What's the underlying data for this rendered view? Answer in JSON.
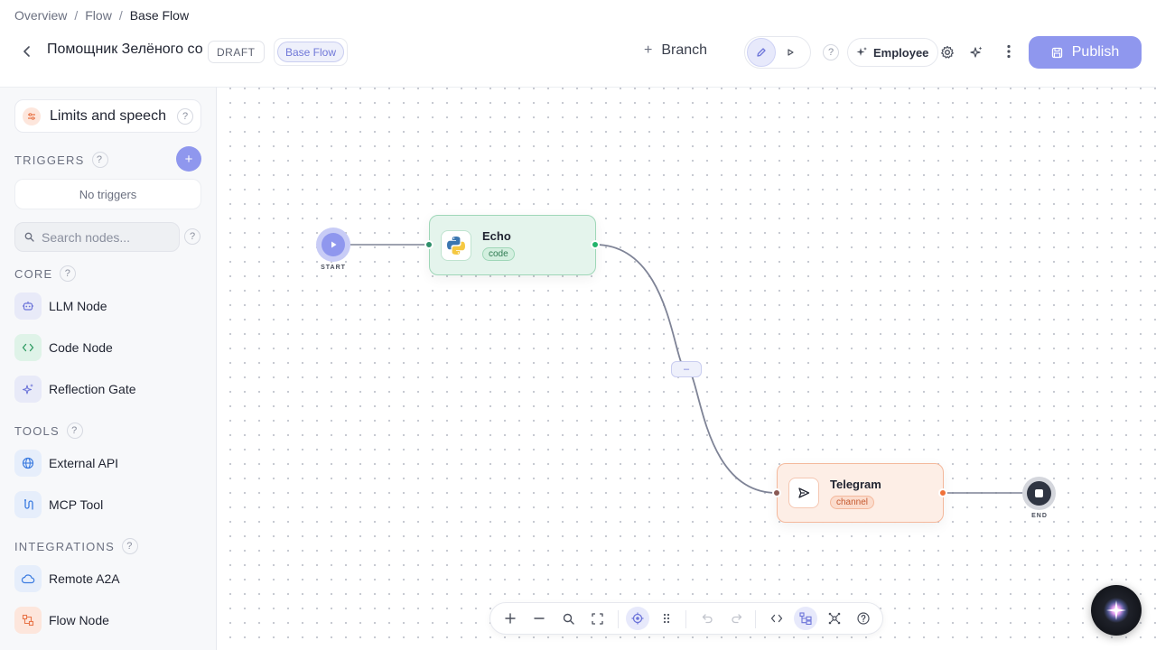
{
  "breadcrumb": {
    "items": [
      "Overview",
      "Flow"
    ],
    "current": "Base Flow",
    "separator": "/"
  },
  "header": {
    "title": "Помощник Зелёного со",
    "status_badge": "DRAFT",
    "flow_pill": "Base Flow",
    "branch_label": "Branch",
    "help_mark": "?",
    "employee_label": "Employee",
    "publish_label": "Publish"
  },
  "sidebar": {
    "limits_card": "Limits and speech",
    "help_mark": "?",
    "triggers_label": "TRIGGERS",
    "add_trigger": "+",
    "no_triggers": "No triggers",
    "search_placeholder": "Search nodes...",
    "core_label": "CORE",
    "core_items": [
      {
        "label": "LLM Node",
        "icon": "robot-icon"
      },
      {
        "label": "Code Node",
        "icon": "code-icon"
      },
      {
        "label": "Reflection Gate",
        "icon": "sparkle-icon"
      }
    ],
    "tools_label": "TOOLS",
    "tools_items": [
      {
        "label": "External API",
        "icon": "globe-icon"
      },
      {
        "label": "MCP Tool",
        "icon": "plug-icon"
      }
    ],
    "integrations_label": "INTEGRATIONS",
    "integrations_items": [
      {
        "label": "Remote A2A",
        "icon": "cloud-icon"
      },
      {
        "label": "Flow Node",
        "icon": "flow-icon"
      }
    ]
  },
  "canvas": {
    "start_label": "START",
    "end_label": "END",
    "edge_control": "–",
    "nodes": [
      {
        "title": "Echo",
        "tag": "code",
        "icon": "python-icon"
      },
      {
        "title": "Telegram",
        "tag": "channel",
        "icon": "send-icon"
      }
    ]
  },
  "colors": {
    "accent": "#8f97ee",
    "code_node": "#e4f4ec",
    "channel_node": "#fdeee6",
    "edge": "#7e8396"
  }
}
